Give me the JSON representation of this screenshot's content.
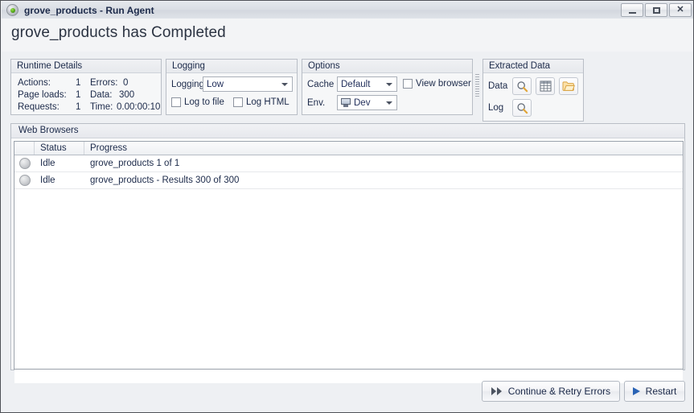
{
  "window": {
    "title": "grove_products - Run Agent",
    "app_icon": "orb-icon",
    "buttons": {
      "minimize": "minimize-button",
      "maximize": "maximize-button",
      "close": "close-button"
    }
  },
  "heading": {
    "text": "grove_products has Completed"
  },
  "runtime_details": {
    "title": "Runtime Details",
    "rows": [
      {
        "label": "Actions:",
        "value": "1",
        "label2": "Errors:",
        "value2": "0"
      },
      {
        "label": "Page loads:",
        "value": "1",
        "label2": "Data:",
        "value2": "300"
      },
      {
        "label": "Requests:",
        "value": "1",
        "label2": "Time:",
        "value2": "0.00:00:10"
      }
    ]
  },
  "logging": {
    "title": "Logging",
    "level_label": "Logging",
    "level_value": "Low",
    "level_options": [
      "Low"
    ],
    "log_to_file": {
      "label": "Log to file",
      "checked": false
    },
    "log_html": {
      "label": "Log HTML",
      "checked": false
    }
  },
  "options": {
    "title": "Options",
    "cache_label": "Cache",
    "cache_value": "Default",
    "cache_options": [
      "Default"
    ],
    "env_label": "Env.",
    "env_value": "Dev",
    "env_options": [
      "Dev"
    ],
    "view_browser": {
      "label": "View browser",
      "checked": false
    }
  },
  "extracted_data": {
    "title": "Extracted Data",
    "data_label": "Data",
    "log_label": "Log",
    "data_buttons": [
      "view-data-magnifier-icon",
      "data-grid-icon",
      "open-folder-icon"
    ],
    "log_buttons": [
      "view-log-magnifier-icon"
    ]
  },
  "web_browsers": {
    "title": "Web Browsers",
    "columns": [
      "",
      "Status",
      "Progress"
    ],
    "rows": [
      {
        "indicator": "idle-dot",
        "status": "Idle",
        "progress": "grove_products 1 of 1"
      },
      {
        "indicator": "idle-dot",
        "status": "Idle",
        "progress": "grove_products - Results 300 of 300"
      }
    ]
  },
  "footer": {
    "continue_label": "Continue & Retry Errors",
    "restart_label": "Restart"
  },
  "colors": {
    "window_bg": "#eef0f3",
    "titlebar": "#dadee4",
    "panel_bg": "#f6f7f8",
    "text": "#1c2a4a",
    "accent_blue": "#2a63b5",
    "folder_orange": "#f0b952"
  }
}
